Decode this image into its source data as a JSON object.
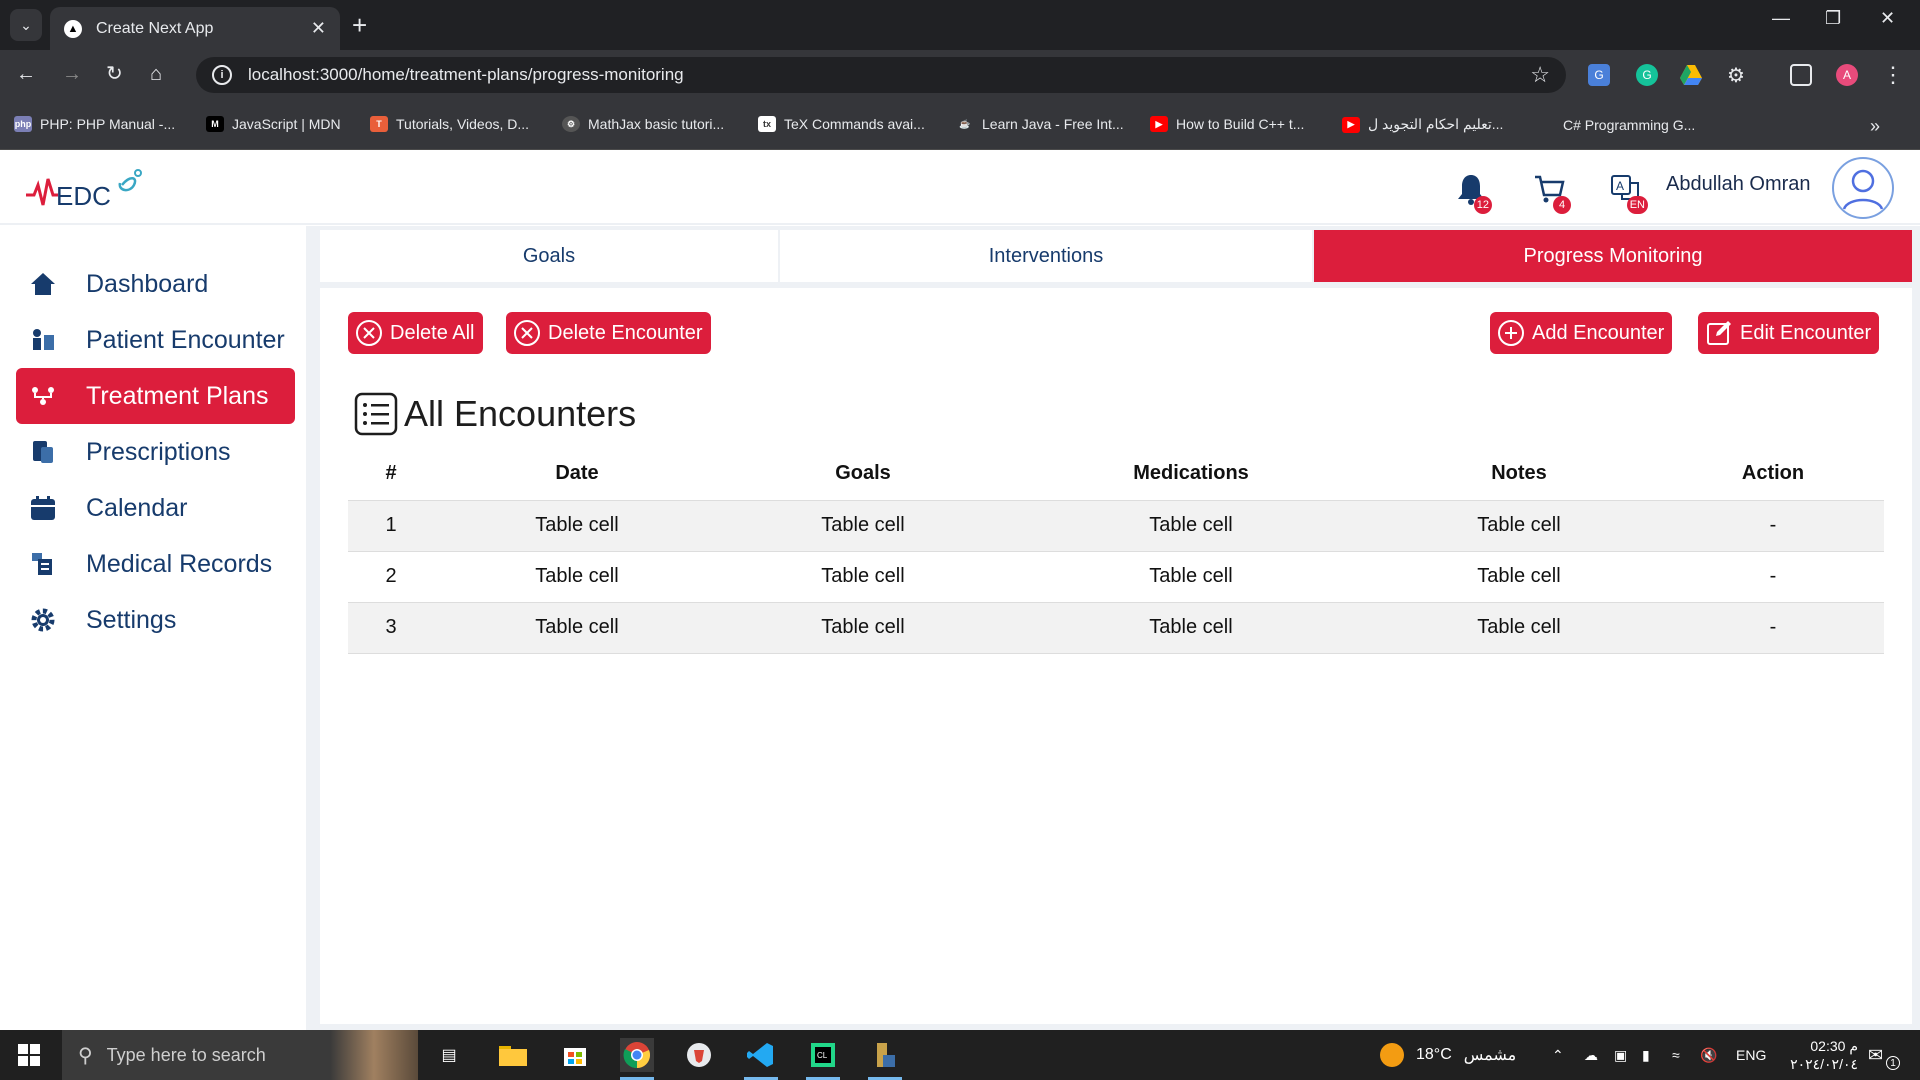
{
  "browser": {
    "tab_title": "Create Next App",
    "url": "localhost:3000/home/treatment-plans/progress-monitoring",
    "bookmarks": [
      {
        "label": "PHP: PHP Manual -...",
        "icon": "php-icon"
      },
      {
        "label": "JavaScript | MDN",
        "icon": "mdn-icon"
      },
      {
        "label": "Tutorials, Videos, D...",
        "icon": "tutorials-icon"
      },
      {
        "label": "MathJax basic tutori...",
        "icon": "mathjax-icon"
      },
      {
        "label": "TeX Commands avai...",
        "icon": "tex-icon"
      },
      {
        "label": "Learn Java - Free Int...",
        "icon": "java-icon"
      },
      {
        "label": "How to Build C++ t...",
        "icon": "youtube-icon"
      },
      {
        "label": "تعليم احكام التجويد ل...",
        "icon": "youtube-icon"
      },
      {
        "label": "C# Programming G...",
        "icon": "microsoft-icon"
      }
    ],
    "profile_initial": "A"
  },
  "header": {
    "logo_text": "EDC",
    "notifications_count": "12",
    "cart_count": "4",
    "lang_badge": "EN",
    "user_name": "Abdullah Omran"
  },
  "sidebar": {
    "items": [
      {
        "label": "Dashboard",
        "icon": "home-icon"
      },
      {
        "label": "Patient Encounter",
        "icon": "encounter-icon"
      },
      {
        "label": "Treatment Plans",
        "icon": "treatment-icon",
        "active": true
      },
      {
        "label": "Prescriptions",
        "icon": "prescriptions-icon"
      },
      {
        "label": "Calendar",
        "icon": "calendar-icon"
      },
      {
        "label": "Medical Records",
        "icon": "records-icon"
      },
      {
        "label": "Settings",
        "icon": "gear-icon"
      }
    ]
  },
  "tabs": [
    {
      "label": "Goals"
    },
    {
      "label": "Interventions"
    },
    {
      "label": "Progress Monitoring",
      "active": true
    }
  ],
  "actions": {
    "delete_all": "Delete All",
    "delete_encounter": "Delete Encounter",
    "add_encounter": "Add Encounter",
    "edit_encounter": "Edit Encounter"
  },
  "section_title": "All Encounters",
  "table": {
    "headers": [
      "#",
      "Date",
      "Goals",
      "Medications",
      "Notes",
      "Action"
    ],
    "rows": [
      [
        "1",
        "Table cell",
        "Table cell",
        "Table cell",
        "Table cell",
        "-"
      ],
      [
        "2",
        "Table cell",
        "Table cell",
        "Table cell",
        "Table cell",
        "-"
      ],
      [
        "3",
        "Table cell",
        "Table cell",
        "Table cell",
        "Table cell",
        "-"
      ]
    ]
  },
  "taskbar": {
    "search_placeholder": "Type here to search",
    "weather_temp": "18°C",
    "weather_text": "مشمس",
    "language": "ENG",
    "time": "02:30 م",
    "date": "٢٠٢٤/٠٢/٠٤",
    "notification_count": "1"
  },
  "colors": {
    "accent": "#dc1e3c",
    "navy": "#173b6c",
    "main_bg": "#eef1f5"
  }
}
